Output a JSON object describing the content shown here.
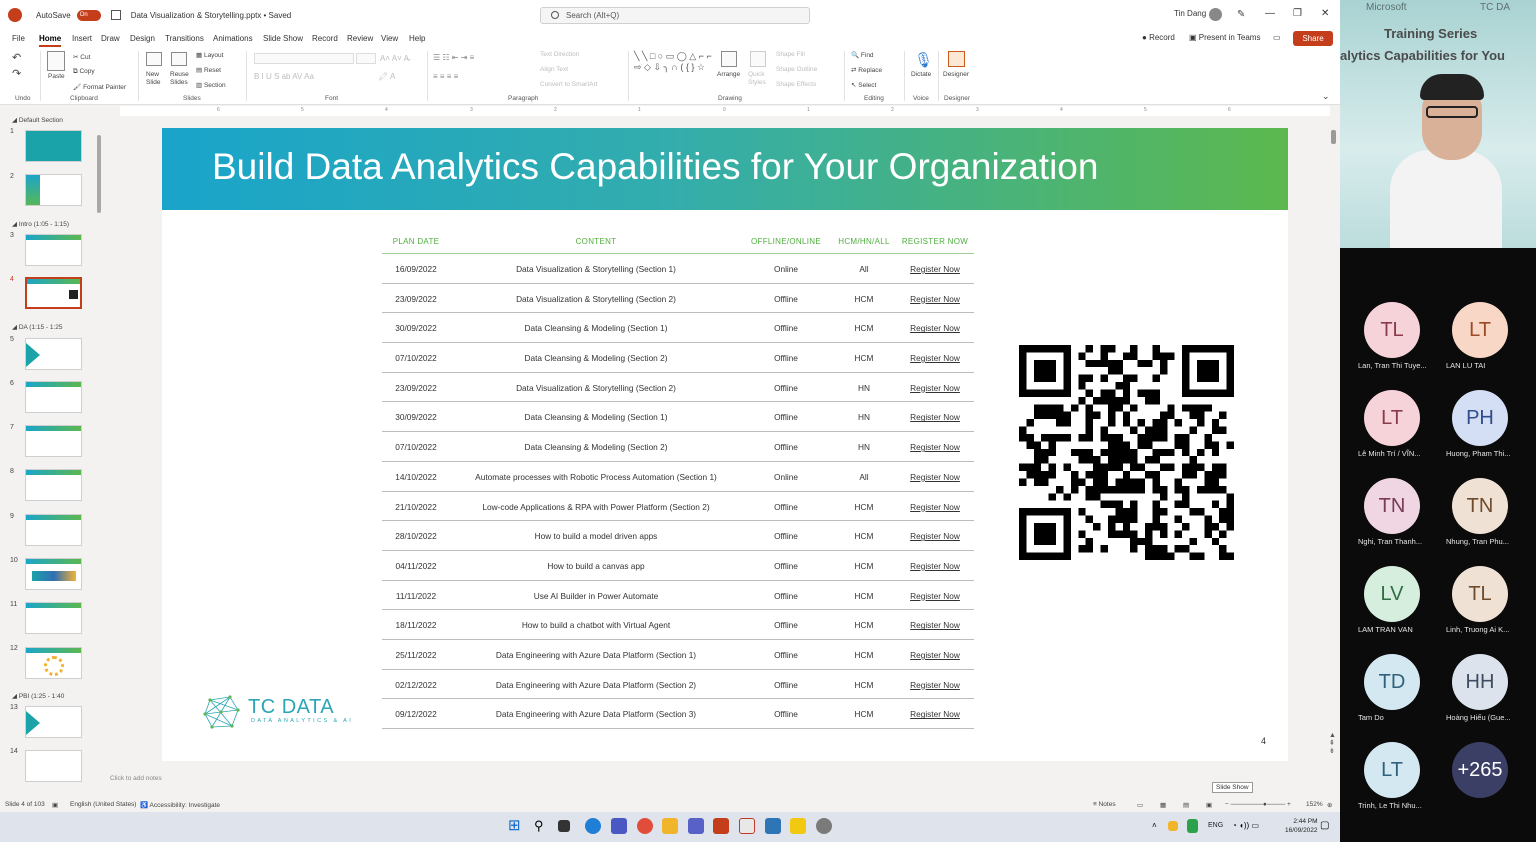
{
  "app": {
    "autosave_label": "AutoSave",
    "autosave_state": "On",
    "file_title": "Data Visualization & Storytelling.pptx • Saved",
    "search_placeholder": "Search (Alt+Q)",
    "user_name": "Tin Dang"
  },
  "menu": [
    "File",
    "Home",
    "Insert",
    "Draw",
    "Design",
    "Transitions",
    "Animations",
    "Slide Show",
    "Record",
    "Review",
    "View",
    "Help"
  ],
  "menu_right": {
    "record": "Record",
    "present": "Present in Teams",
    "share": "Share"
  },
  "ribbon": {
    "undo": "Undo",
    "paste": "Paste",
    "cut": "Cut",
    "copy": "Copy",
    "format_painter": "Format Painter",
    "clipboard": "Clipboard",
    "new_slide": "New Slide",
    "reuse_slides": "Reuse Slides",
    "layout": "Layout",
    "reset": "Reset",
    "section": "Section",
    "slides": "Slides",
    "font": "Font",
    "text_direction": "Text Direction",
    "align_text": "Align Text",
    "convert_smartart": "Convert to SmartArt",
    "paragraph": "Paragraph",
    "arrange": "Arrange",
    "quick_styles": "Quick Styles",
    "shape_fill": "Shape Fill",
    "shape_outline": "Shape Outline",
    "shape_effects": "Shape Effects",
    "drawing": "Drawing",
    "find": "Find",
    "replace": "Replace",
    "select": "Select",
    "editing": "Editing",
    "dictate": "Dictate",
    "voice": "Voice",
    "designer": "Designer",
    "designer_group": "Designer"
  },
  "ruler": [
    "6",
    "5",
    "4",
    "3",
    "2",
    "1",
    "0",
    "1",
    "2",
    "3",
    "4",
    "5",
    "6"
  ],
  "thumbnails": {
    "sections": [
      "Default Section",
      "Intro (1:05 - 1:15)",
      "DA (1:15 - 1:25",
      "PBI (1:25 - 1:40"
    ],
    "numbers": [
      "1",
      "2",
      "3",
      "4",
      "5",
      "6",
      "7",
      "8",
      "9",
      "10",
      "11",
      "12",
      "13",
      "14"
    ]
  },
  "slide": {
    "title": "Build Data Analytics Capabilities for Your Organization",
    "number": "4",
    "logo_name": "TC DATA",
    "logo_tagline": "DATA ANALYTICS & AI",
    "table": {
      "headers": [
        "PLAN DATE",
        "CONTENT",
        "OFFLINE/ONLINE",
        "HCM/HN/ALL",
        "REGISTER NOW"
      ],
      "rows": [
        [
          "16/09/2022",
          "Data Visualization & Storytelling (Section 1)",
          "Online",
          "All",
          "Register Now"
        ],
        [
          "23/09/2022",
          "Data Visualization & Storytelling (Section 2)",
          "Offline",
          "HCM",
          "Register Now"
        ],
        [
          "30/09/2022",
          "Data Cleansing & Modeling (Section 1)",
          "Offline",
          "HCM",
          "Register Now"
        ],
        [
          "07/10/2022",
          "Data Cleansing & Modeling (Section 2)",
          "Offline",
          "HCM",
          "Register Now"
        ],
        [
          "23/09/2022",
          "Data Visualization & Storytelling (Section 2)",
          "Offline",
          "HN",
          "Register Now"
        ],
        [
          "30/09/2022",
          "Data Cleansing & Modeling (Section 1)",
          "Offline",
          "HN",
          "Register Now"
        ],
        [
          "07/10/2022",
          "Data Cleansing & Modeling (Section 2)",
          "Offline",
          "HN",
          "Register Now"
        ],
        [
          "14/10/2022",
          "Automate processes with Robotic Process Automation (Section 1)",
          "Online",
          "All",
          "Register Now"
        ],
        [
          "21/10/2022",
          "Low-code Applications & RPA with Power Platform (Section 2)",
          "Offline",
          "HCM",
          "Register Now"
        ],
        [
          "28/10/2022",
          "How to build a model driven apps",
          "Offline",
          "HCM",
          "Register Now"
        ],
        [
          "04/11/2022",
          "How to build a canvas app",
          "Offline",
          "HCM",
          "Register Now"
        ],
        [
          "11/11/2022",
          "Use AI Builder in Power Automate",
          "Offline",
          "HCM",
          "Register Now"
        ],
        [
          "18/11/2022",
          "How to build a chatbot with Virtual Agent",
          "Offline",
          "HCM",
          "Register Now"
        ],
        [
          "25/11/2022",
          "Data Engineering with Azure Data Platform (Section 1)",
          "Offline",
          "HCM",
          "Register Now"
        ],
        [
          "02/12/2022",
          "Data Engineering with Azure Data Platform (Section 2)",
          "Offline",
          "HCM",
          "Register Now"
        ],
        [
          "09/12/2022",
          "Data Engineering with Azure Data Platform (Section 3)",
          "Offline",
          "HCM",
          "Register Now"
        ]
      ]
    }
  },
  "notes_placeholder": "Click to add notes",
  "status": {
    "slide_count": "Slide 4 of 103",
    "language": "English (United States)",
    "accessibility": "Accessibility: Investigate",
    "notes": "Notes",
    "tooltip": "Slide Show",
    "zoom": "152%"
  },
  "taskbar": {
    "lang": "ENG",
    "time": "2:44 PM",
    "date": "16/09/2022"
  },
  "teams": {
    "video_ms": "Microsoft",
    "video_tc": "TC DA",
    "video_series": "Training Series",
    "video_sub": "alytics Capabilities for You",
    "participants": [
      {
        "initials": "TL",
        "name": "Lan, Tran Thi Tuye...",
        "bg": "#f6d3d8",
        "fg": "#8a3b4b"
      },
      {
        "initials": "LT",
        "name": "LAN LU TAI",
        "bg": "#f8d7c6",
        "fg": "#9a4a25"
      },
      {
        "initials": "LT",
        "name": "Lê Minh Trí / VĨN...",
        "bg": "#f6d3d8",
        "fg": "#8a3b4b"
      },
      {
        "initials": "PH",
        "name": "Huong, Pham Thi...",
        "bg": "#d4def4",
        "fg": "#2f4d8f"
      },
      {
        "initials": "TN",
        "name": "Nghi, Tran Thanh...",
        "bg": "#f0d6e2",
        "fg": "#7a3b58"
      },
      {
        "initials": "TN",
        "name": "Nhung, Tran Phu...",
        "bg": "#efe2d5",
        "fg": "#6e4b2c"
      },
      {
        "initials": "LV",
        "name": "LAM TRAN VAN",
        "bg": "#d6eede",
        "fg": "#2f6e45"
      },
      {
        "initials": "TL",
        "name": "Linh, Truong Ai K...",
        "bg": "#efe2d5",
        "fg": "#6e4b2c"
      },
      {
        "initials": "TD",
        "name": "Tam Do",
        "bg": "#d4e8f2",
        "fg": "#2f617d"
      },
      {
        "initials": "HH",
        "name": "Hoàng Hiếu (Gue...",
        "bg": "#dde3ec",
        "fg": "#3f4d63"
      },
      {
        "initials": "LT",
        "name": "Trinh, Le Thi Nhu...",
        "bg": "#d4e8f2",
        "fg": "#2f617d"
      },
      {
        "initials": "+265",
        "name": "",
        "bg": "#3b3f66",
        "fg": "#ffffff"
      }
    ]
  }
}
